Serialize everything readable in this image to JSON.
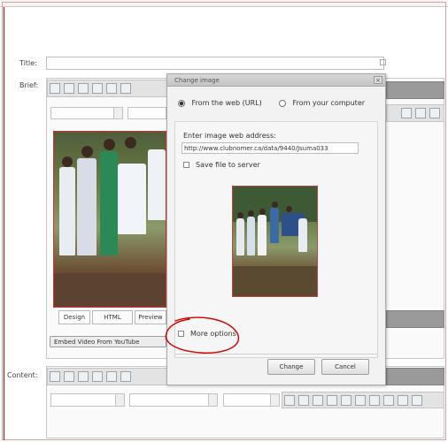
{
  "header": {
    "tab_label": ""
  },
  "form": {
    "title_label": "Title:",
    "brief_label": "Brief:",
    "content_label": "Content:"
  },
  "editor_tabs": {
    "design": "Design",
    "html": "HTML",
    "preview": "Preview"
  },
  "embed_video_label": "Embed Video From YouTube",
  "dialog": {
    "title": "Change image",
    "close_glyph": "×",
    "source_web": "From the web (URL)",
    "source_computer": "From your computer",
    "url_label": "Enter image web address:",
    "url_value": "http://www.clubnomer.ca/data/9440/Jsuma033",
    "save_to_server": "Save file to server",
    "more_options": "More options",
    "change_button": "Change",
    "cancel_button": "Cancel"
  },
  "annotation": {
    "color": "#d40000",
    "shape": "hand-drawn ellipse around More options"
  }
}
